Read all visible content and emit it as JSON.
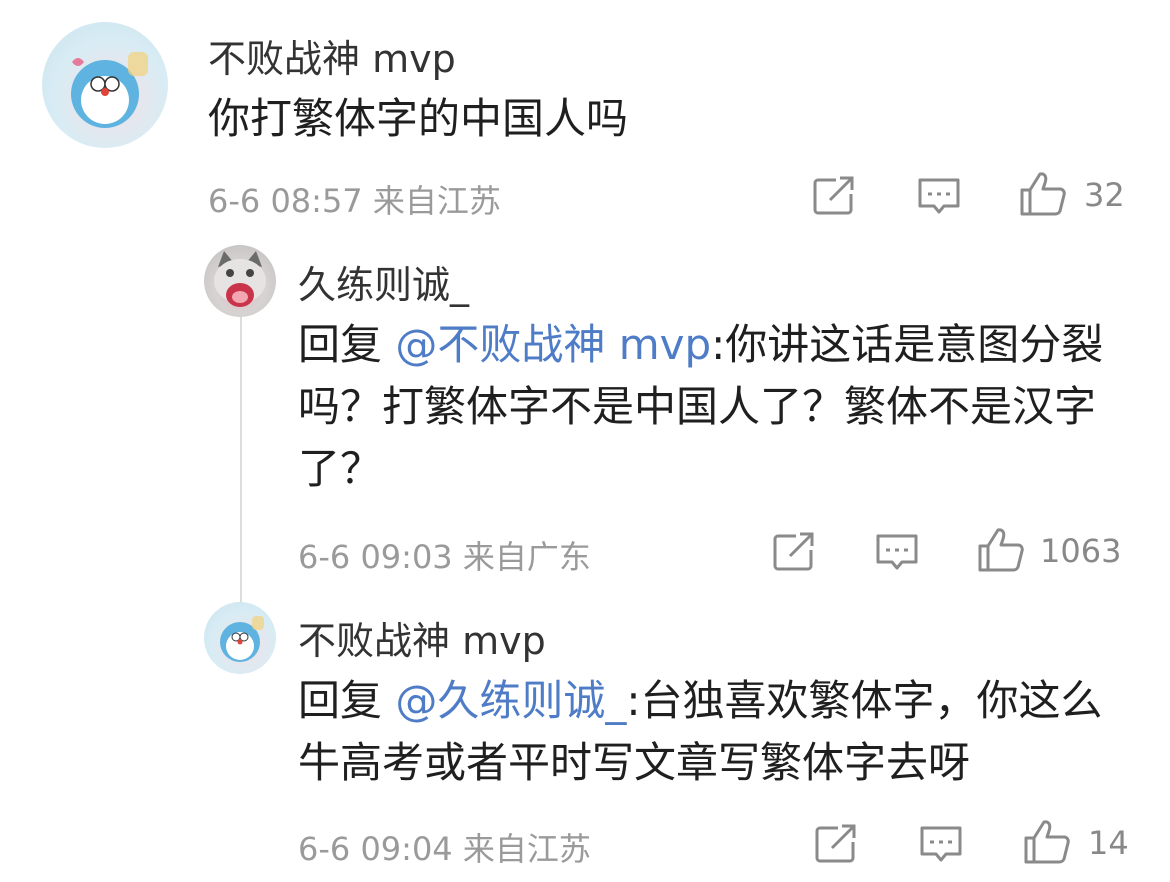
{
  "comments": [
    {
      "username": "不败战神 mvp",
      "text": "你打繁体字的中国人吗",
      "time": "6-6 08:57",
      "location": "来自江苏",
      "likes": "32",
      "avatar_icon": "doraemon-avatar"
    },
    {
      "username": "久练则诚_",
      "reply_prefix": "回复 ",
      "mention": "@不败战神 mvp",
      "text": ":你讲这话是意图分裂吗？打繁体字不是中国人了？繁体不是汉字了？",
      "time": "6-6 09:03",
      "location": "来自广东",
      "likes": "1063",
      "avatar_icon": "cat-avatar"
    },
    {
      "username": "不败战神 mvp",
      "reply_prefix": "回复 ",
      "mention": "@久练则诚_",
      "text": ":台独喜欢繁体字，你这么牛高考或者平时写文章写繁体字去呀",
      "time": "6-6 09:04",
      "location": "来自江苏",
      "likes": "14",
      "avatar_icon": "doraemon-avatar"
    }
  ],
  "colors": {
    "mention": "#4f7cc7",
    "meta": "#9a9a9a",
    "icon": "#8a8a8a"
  },
  "icons": [
    "share-icon",
    "comment-icon",
    "like-icon"
  ]
}
